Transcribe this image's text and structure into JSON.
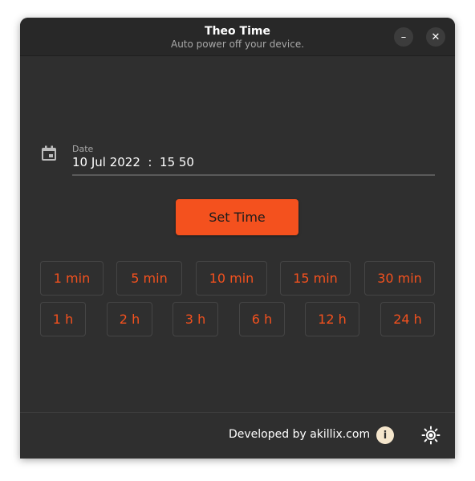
{
  "window": {
    "title": "Theo Time",
    "subtitle": "Auto power off your device.",
    "minimize_glyph": "–",
    "close_glyph": "✕"
  },
  "date": {
    "label": "Date",
    "value": "10 Jul 2022  :  15 50",
    "icon": "calendar-icon"
  },
  "set_time_label": "Set Time",
  "timers_row1": [
    "1 min",
    "5 min",
    "10 min",
    "15 min",
    "30 min"
  ],
  "timers_row2": [
    "1 h",
    "2 h",
    "3 h",
    "6 h",
    "12 h",
    "24 h"
  ],
  "footer": {
    "developed_by": "Developed by akillix.com",
    "info_glyph": "i",
    "theme_icon": "sun-icon"
  },
  "colors": {
    "accent": "#f4511e",
    "window_bg": "#2f2f2f",
    "titlebar_bg": "#282828"
  }
}
